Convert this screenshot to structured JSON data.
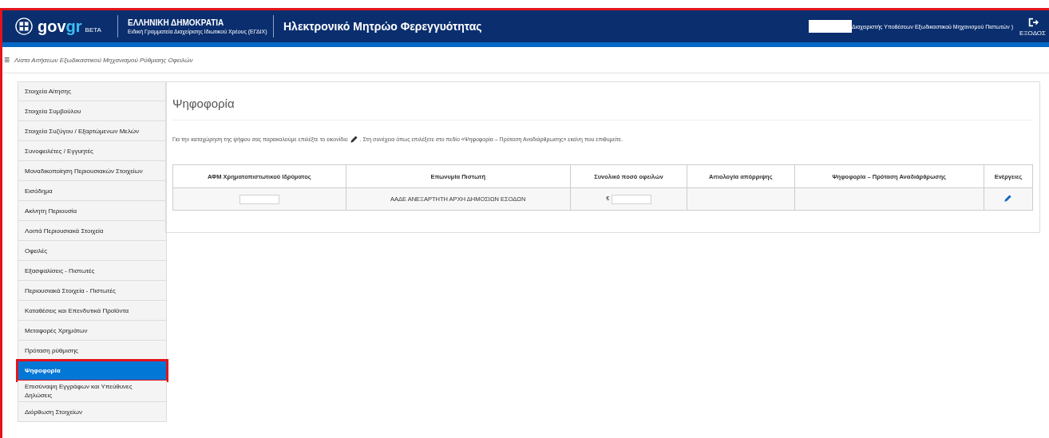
{
  "header": {
    "logo_text": "gov",
    "logo_accent": "gr",
    "logo_badge": "BETA",
    "org_title": "ΕΛΛΗΝΙΚΗ ΔΗΜΟΚΡΑΤΙΑ",
    "org_subtitle": "Ειδική Γραμματεία Διαχείρισης Ιδιωτικού Χρέους (ΕΓΔΙΧ)",
    "app_title": "Ηλεκτρονικό Μητρώο Φερεγγυότητας",
    "user_role": "Διαχειριστής Υποθέσεων Εξωδικαστικού Μηχανισμού Πιστωτών )",
    "logout_label": "ΕΞΟΔΟΣ"
  },
  "breadcrumb": {
    "icon": "≡",
    "text": "Λίστα Αιτήσεων Εξωδικαστικού Μηχανισμού Ρύθμισης Οφειλών"
  },
  "sidebar": {
    "items": [
      {
        "label": "Στοιχεία Αίτησης",
        "selected": false
      },
      {
        "label": "Στοιχεία Συμβούλου",
        "selected": false
      },
      {
        "label": "Στοιχεία Συζύγου / Εξαρτώμενων Μελών",
        "selected": false
      },
      {
        "label": "Συνοφειλέτες / Εγγυητές",
        "selected": false
      },
      {
        "label": "Μοναδικοποίηση Περιουσιακών Στοιχείων",
        "selected": false
      },
      {
        "label": "Εισόδημα",
        "selected": false
      },
      {
        "label": "Ακίνητη Περιουσία",
        "selected": false
      },
      {
        "label": "Λοιπά Περιουσιακά Στοιχεία",
        "selected": false
      },
      {
        "label": "Οφειλές",
        "selected": false
      },
      {
        "label": "Εξασφαλίσεις - Πιστωτές",
        "selected": false
      },
      {
        "label": "Περιουσιακά Στοιχεία - Πιστωτές",
        "selected": false
      },
      {
        "label": "Καταθέσεις και Επενδυτικά Προϊόντα",
        "selected": false
      },
      {
        "label": "Μεταφορές Χρημάτων",
        "selected": false
      },
      {
        "label": "Πρόταση ρύθμισης",
        "selected": false
      },
      {
        "label": "Ψηφοφορία",
        "selected": true
      },
      {
        "label": "Επισύναψη Εγγράφων και Υπεύθυνες Δηλώσεις",
        "selected": false
      },
      {
        "label": "Διόρθωση Στοιχείων",
        "selected": false
      }
    ]
  },
  "panel": {
    "title": "Ψηφοφορία",
    "instruction_before": "Για την καταχώρηση της ψήφου σας παρακαλούμε επιλέξτε το εικονίδιο",
    "instruction_after": ". Στη συνέχεια όπως επιλέξετε στο πεδίο «Ψηφοφορία – Πρόταση Αναδιάρθρωσης» εκείνη που επιθυμείτε."
  },
  "table": {
    "columns": [
      "ΑΦΜ Χρηματοπιστωτικού Ιδρύματος",
      "Επωνυμία Πιστωτή",
      "Συνολικό ποσό οφειλών",
      "Αιτιολογία απόρριψης",
      "Ψηφοφορία – Πρόταση Αναδιάρθρωσης",
      "Ενέργειες"
    ],
    "rows": [
      {
        "creditor": "ΑΑΔΕ ΑΝΕΞΑΡΤΗΤΗ ΑΡΧΗ ΔΗΜΟΣΙΩΝ ΕΣΟΔΩΝ",
        "currency": "€"
      }
    ]
  }
}
